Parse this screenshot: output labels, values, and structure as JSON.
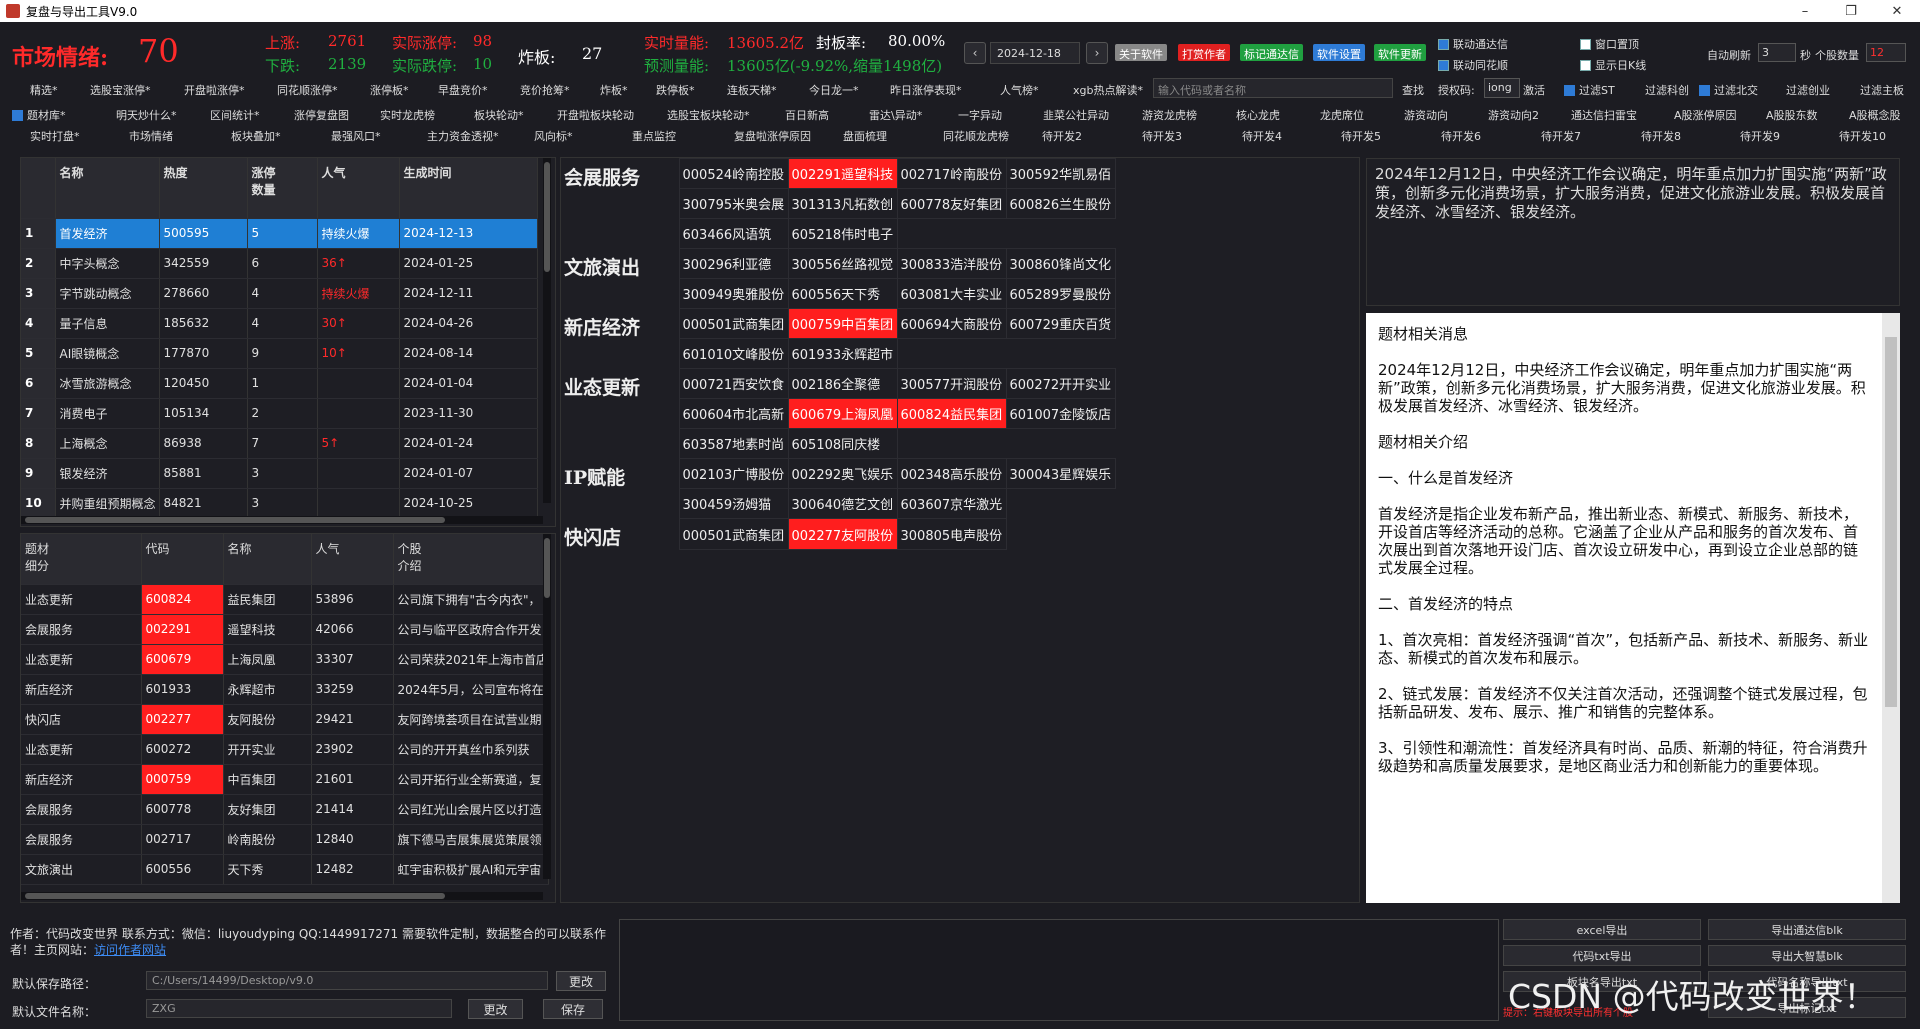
{
  "title": "复盘与导出工具V9.0",
  "window_controls": [
    "–",
    "❐",
    "✕"
  ],
  "market": {
    "label": "市场情绪:",
    "value": "70",
    "up_label": "上涨:",
    "up_value": "2761",
    "down_label": "下跌:",
    "down_value": "2139",
    "limit_up_label": "实际涨停:",
    "limit_up_value": "98",
    "limit_down_label": "实际跌停:",
    "limit_down_value": "10",
    "broken_label": "炸板:",
    "broken_value": "27",
    "volume_label": "实时量能:",
    "volume_value": "13605.2亿",
    "seal_label": "封板率:",
    "seal_value": "80.00%",
    "forecast_label": "预测量能:",
    "forecast_value": "13605亿(-9.92%,缩量1498亿)"
  },
  "date": "2024-12-18",
  "nav": {
    "prev": "‹",
    "next": "›"
  },
  "top_buttons": [
    {
      "label": "关于软件",
      "color": "#888888"
    },
    {
      "label": "打赏作者",
      "color": "#e02020"
    },
    {
      "label": "标记通达信",
      "color": "#20a040"
    },
    {
      "label": "软件设置",
      "color": "#2e7bd6"
    },
    {
      "label": "软件更新",
      "color": "#20a040"
    }
  ],
  "checks": {
    "link_tdx": "联动通达信",
    "link_ths": "联动同花顺",
    "window_top": "窗口置顶",
    "show_daily": "显示日K线"
  },
  "auto_refresh": {
    "label": "自动刷新",
    "value": "3",
    "unit": "秒",
    "stock_count_label": "个股数量",
    "stock_count": "12"
  },
  "menu_row1": [
    "精选*",
    "选股宝涨停*",
    "开盘啦涨停*",
    "同花顺涨停*",
    "涨停板*",
    "早盘竞价*",
    "竞价抢筹*",
    "炸板*",
    "跌停板*",
    "连板天梯*",
    "今日龙一*",
    "昨日涨停表现*",
    "人气榜*",
    "xgb热点解读*"
  ],
  "search_placeholder": "输入代码或者名称",
  "search_label": "查找",
  "auth_label": "授权码:",
  "auth_value": "iong",
  "activate_label": "激活",
  "filters": [
    "过滤ST",
    "过滤科创",
    "过滤北交",
    "过滤创业",
    "过滤主板"
  ],
  "menu_row2": [
    "题材库*",
    "明天炒什么*",
    "区间统计*",
    "涨停复盘图",
    "实时龙虎榜",
    "板块轮动*",
    "开盘啦板块轮动",
    "选股宝板块轮动*",
    "百日新高",
    "雷达\\异动*",
    "一字异动",
    "韭菜公社异动",
    "游资龙虎榜",
    "核心龙虎",
    "龙虎席位",
    "游资动向",
    "游资动向2",
    "通达信扫雷宝",
    "A股涨停原因",
    "A股股东数",
    "A股概念股"
  ],
  "menu_row3": [
    "实时打盘*",
    "市场情绪",
    "板块叠加*",
    "最强风口*",
    "主力资金透视*",
    "风向标*",
    "重点监控",
    "复盘啦涨停原因",
    "盘面梳理",
    "同花顺龙虎榜",
    "待开发2",
    "待开发3",
    "待开发4",
    "待开发5",
    "待开发6",
    "待开发7",
    "待开发8",
    "待开发9",
    "待开发10"
  ],
  "theme_table": {
    "headers": [
      "名称",
      "热度",
      "涨停\n数量",
      "人气",
      "生成时间"
    ],
    "rows": [
      {
        "idx": "1",
        "name": "首发经济",
        "heat": "500595",
        "limit": "5",
        "pop": "持续火爆",
        "date": "2024-12-13",
        "sel": true,
        "hot": false
      },
      {
        "idx": "2",
        "name": "中字头概念",
        "heat": "342559",
        "limit": "6",
        "pop": "36↑",
        "date": "2024-01-25",
        "sel": false,
        "hot": true
      },
      {
        "idx": "3",
        "name": "字节跳动概念",
        "heat": "278660",
        "limit": "4",
        "pop": "持续火爆",
        "date": "2024-12-11",
        "sel": false,
        "hot": true
      },
      {
        "idx": "4",
        "name": "量子信息",
        "heat": "185632",
        "limit": "4",
        "pop": "30↑",
        "date": "2024-04-26",
        "sel": false,
        "hot": true
      },
      {
        "idx": "5",
        "name": "AI眼镜概念",
        "heat": "177870",
        "limit": "9",
        "pop": "10↑",
        "date": "2024-08-14",
        "sel": false,
        "hot": true
      },
      {
        "idx": "6",
        "name": "冰雪旅游概念",
        "heat": "120450",
        "limit": "1",
        "pop": "",
        "date": "2024-01-04",
        "sel": false,
        "hot": false
      },
      {
        "idx": "7",
        "name": "消费电子",
        "heat": "105134",
        "limit": "2",
        "pop": "",
        "date": "2023-11-30",
        "sel": false,
        "hot": false
      },
      {
        "idx": "8",
        "name": "上海概念",
        "heat": "86938",
        "limit": "7",
        "pop": "5↑",
        "date": "2024-01-24",
        "sel": false,
        "hot": true
      },
      {
        "idx": "9",
        "name": "银发经济",
        "heat": "85881",
        "limit": "3",
        "pop": "",
        "date": "2024-01-07",
        "sel": false,
        "hot": false
      },
      {
        "idx": "10",
        "name": "并购重组预期概念",
        "heat": "84821",
        "limit": "3",
        "pop": "",
        "date": "2024-10-25",
        "sel": false,
        "hot": false
      }
    ]
  },
  "stock_table": {
    "headers": [
      "题材\n细分",
      "代码",
      "名称",
      "人气",
      "个股\n介绍"
    ],
    "rows": [
      {
        "sub": "业态更新",
        "code": "600824",
        "name": "益民集团",
        "pop": "53896",
        "intro": "公司旗下拥有\"古今内衣\"，",
        "red": true
      },
      {
        "sub": "会展服务",
        "code": "002291",
        "name": "遥望科技",
        "pop": "42066",
        "intro": "公司与临平区政府合作开发",
        "red": true
      },
      {
        "sub": "业态更新",
        "code": "600679",
        "name": "上海凤凰",
        "pop": "33307",
        "intro": "公司荣获2021年上海市首店",
        "red": true
      },
      {
        "sub": "新店经济",
        "code": "601933",
        "name": "永辉超市",
        "pop": "33259",
        "intro": "2024年5月，公司宣布将在",
        "red": false
      },
      {
        "sub": "快闪店",
        "code": "002277",
        "name": "友阿股份",
        "pop": "29421",
        "intro": "友阿跨境荟项目在试营业期",
        "red": true
      },
      {
        "sub": "业态更新",
        "code": "600272",
        "name": "开开实业",
        "pop": "23902",
        "intro": "公司的开开真丝巾系列获",
        "red": false
      },
      {
        "sub": "新店经济",
        "code": "000759",
        "name": "中百集团",
        "pop": "21601",
        "intro": "公司开拓行业全新赛道，复",
        "red": true
      },
      {
        "sub": "会展服务",
        "code": "600778",
        "name": "友好集团",
        "pop": "21414",
        "intro": "公司红光山会展片区以打造",
        "red": false
      },
      {
        "sub": "会展服务",
        "code": "002717",
        "name": "岭南股份",
        "pop": "12840",
        "intro": "旗下德马吉展集展览策展领",
        "red": false
      },
      {
        "sub": "文旅演出",
        "code": "600556",
        "name": "天下秀",
        "pop": "12482",
        "intro": "虹宇宙积极扩展AI和元宇宙",
        "red": false
      }
    ]
  },
  "groups": [
    {
      "name": "会展服务",
      "rows": [
        [
          {
            "t": "000524岭南控股",
            "r": false
          },
          {
            "t": "002291遥望科技",
            "r": true
          },
          {
            "t": "002717岭南股份",
            "r": false
          },
          {
            "t": "300592华凯易佰",
            "r": false
          }
        ],
        [
          {
            "t": "300795米奥会展",
            "r": false
          },
          {
            "t": "301313凡拓数创",
            "r": false
          },
          {
            "t": "600778友好集团",
            "r": false
          },
          {
            "t": "600826兰生股份",
            "r": false
          }
        ],
        [
          {
            "t": "603466风语筑",
            "r": false
          },
          {
            "t": "605218伟时电子",
            "r": false
          }
        ]
      ]
    },
    {
      "name": "文旅演出",
      "rows": [
        [
          {
            "t": "300296利亚德",
            "r": false
          },
          {
            "t": "300556丝路视觉",
            "r": false
          },
          {
            "t": "300833浩洋股份",
            "r": false
          },
          {
            "t": "300860锋尚文化",
            "r": false
          }
        ],
        [
          {
            "t": "300949奥雅股份",
            "r": false
          },
          {
            "t": "600556天下秀",
            "r": false
          },
          {
            "t": "603081大丰实业",
            "r": false
          },
          {
            "t": "605289罗曼股份",
            "r": false
          }
        ]
      ]
    },
    {
      "name": "新店经济",
      "rows": [
        [
          {
            "t": "000501武商集团",
            "r": false
          },
          {
            "t": "000759中百集团",
            "r": true
          },
          {
            "t": "600694大商股份",
            "r": false
          },
          {
            "t": "600729重庆百货",
            "r": false
          }
        ],
        [
          {
            "t": "601010文峰股份",
            "r": false
          },
          {
            "t": "601933永辉超市",
            "r": false
          }
        ]
      ]
    },
    {
      "name": "业态更新",
      "rows": [
        [
          {
            "t": "000721西安饮食",
            "r": false
          },
          {
            "t": "002186全聚德",
            "r": false
          },
          {
            "t": "300577开润股份",
            "r": false
          },
          {
            "t": "600272开开实业",
            "r": false
          }
        ],
        [
          {
            "t": "600604市北高新",
            "r": false
          },
          {
            "t": "600679上海凤凰",
            "r": true
          },
          {
            "t": "600824益民集团",
            "r": true
          },
          {
            "t": "601007金陵饭店",
            "r": false
          }
        ],
        [
          {
            "t": "603587地素时尚",
            "r": false
          },
          {
            "t": "605108同庆楼",
            "r": false
          }
        ]
      ]
    },
    {
      "name": "IP赋能",
      "rows": [
        [
          {
            "t": "002103广博股份",
            "r": false
          },
          {
            "t": "002292奥飞娱乐",
            "r": false
          },
          {
            "t": "002348高乐股份",
            "r": false
          },
          {
            "t": "300043星辉娱乐",
            "r": false
          }
        ],
        [
          {
            "t": "300459汤姆猫",
            "r": false
          },
          {
            "t": "300640德艺文创",
            "r": false
          },
          {
            "t": "603607京华激光",
            "r": false
          }
        ]
      ]
    },
    {
      "name": "快闪店",
      "rows": [
        [
          {
            "t": "000501武商集团",
            "r": false
          },
          {
            "t": "002277友阿股份",
            "r": true
          },
          {
            "t": "300805电声股份",
            "r": false
          }
        ]
      ]
    }
  ],
  "news_summary": "2024年12月12日，中央经济工作会议确定，明年重点加力扩围实施“两新”政策，创新多元化消费场景，扩大服务消费，促进文化旅游业发展。积极发展首发经济、冰雪经济、银发经济。",
  "news_detail": [
    "题材相关消息",
    "2024年12月12日，中央经济工作会议确定，明年重点加力扩围实施“两新”政策，创新多元化消费场景，扩大服务消费，促进文化旅游业发展。积极发展首发经济、冰雪经济、银发经济。",
    "题材相关介绍",
    "一、什么是首发经济",
    "首发经济是指企业发布新产品，推出新业态、新模式、新服务、新技术，开设首店等经济活动的总称。它涵盖了企业从产品和服务的首次发布、首次展出到首次落地开设门店、首次设立研发中心，再到设立企业总部的链式发展全过程。",
    "二、首发经济的特点",
    "1、首次亮相：首发经济强调“首次”，包括新产品、新技术、新服务、新业态、新模式的首次发布和展示。",
    "2、链式发展：首发经济不仅关注首次活动，还强调整个链式发展过程，包括新品研发、发布、展示、推广和销售的完整体系。",
    "3、引领性和潮流性：首发经济具有时尚、品质、新潮的特征，符合消费升级趋势和高质量发展要求，是地区商业活力和创新能力的重要体现。"
  ],
  "footer": {
    "author": "作者：代码改变世界  联系方式：微信：liuyoudyping QQ:1449917271 需要软件定制，数据整合的可以联系作者！主页网站：",
    "link": "访问作者网站",
    "save_path_label": "默认保存路径：",
    "save_path": "C:/Users/14499/Desktop/v9.0",
    "change1": "更改",
    "file_name_label": "默认文件名称：",
    "file_name": "ZXG",
    "change2": "更改",
    "save": "保存"
  },
  "export_buttons": [
    "excel导出",
    "导出通达信blk",
    "代码txt导出",
    "导出大智慧blk",
    "板块名导出txt",
    "代码名称导出txt",
    "",
    "导出标记txt"
  ],
  "watermark": "CSDN @代码改变世界！",
  "hint": "提示：右键板块导出所有个股"
}
